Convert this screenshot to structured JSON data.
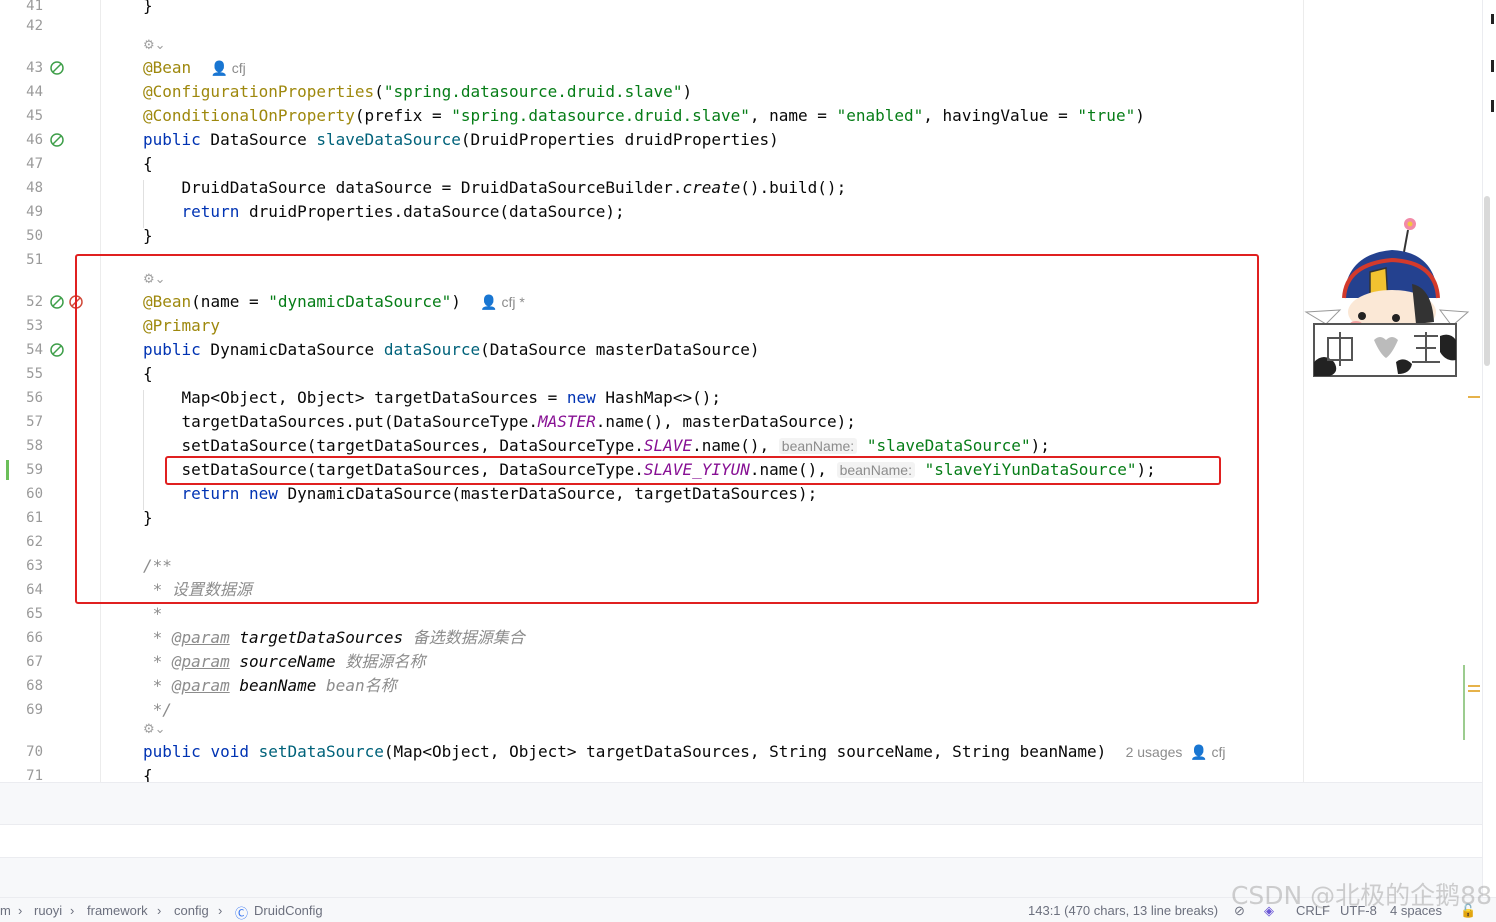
{
  "editor": {
    "lines": [
      {
        "n": "41",
        "html": "}"
      },
      {
        "n": "42",
        "html": ""
      },
      {
        "n": "43",
        "html": "<span class='a'>@Bean</span>  <span class='meta'>&#128100; cfj</span>"
      },
      {
        "n": "44",
        "html": "<span class='a'>@ConfigurationProperties</span>(<span class='s'>\"spring.datasource.druid.slave\"</span>)"
      },
      {
        "n": "45",
        "html": "<span class='a'>@ConditionalOnProperty</span>(prefix = <span class='s'>\"spring.datasource.druid.slave\"</span>, name = <span class='s'>\"enabled\"</span>, havingValue = <span class='s'>\"true\"</span>)"
      },
      {
        "n": "46",
        "html": "<span class='k'>public</span> DataSource <span class='f'>slaveDataSource</span>(DruidProperties druidProperties)"
      },
      {
        "n": "47",
        "html": "{"
      },
      {
        "n": "48",
        "html": "    DruidDataSource dataSource = DruidDataSourceBuilder.<span class='it'>create</span>().build();"
      },
      {
        "n": "49",
        "html": "    <span class='k'>return</span> druidProperties.dataSource(dataSource);"
      },
      {
        "n": "50",
        "html": "}"
      },
      {
        "n": "51",
        "html": ""
      },
      {
        "n": "52",
        "html": "<span class='a'>@Bean</span>(name = <span class='s'>\"dynamicDataSource\"</span>)  <span class='meta'>&#128100; cfj *</span>"
      },
      {
        "n": "53",
        "html": "<span class='a'>@Primary</span>"
      },
      {
        "n": "54",
        "html": "<span class='k'>public</span> DynamicDataSource <span class='f'>dataSource</span>(DataSource masterDataSource)"
      },
      {
        "n": "55",
        "html": "{"
      },
      {
        "n": "56",
        "html": "    Map&lt;Object, Object&gt; targetDataSources = <span class='k'>new</span> HashMap&lt;&gt;();"
      },
      {
        "n": "57",
        "html": "    targetDataSources.put(DataSourceType.<span class='st'>MASTER</span>.name(), masterDataSource);"
      },
      {
        "n": "58",
        "html": "    setDataSource(targetDataSources, DataSourceType.<span class='st'>SLAVE</span>.name(), <span class='hint'>beanName:</span> <span class='s'>\"slaveDataSource\"</span>);"
      },
      {
        "n": "59",
        "html": "    setDataSource(targetDataSources, DataSourceType.<span class='st'>SLAVE_YIYUN</span>.name(), <span class='hint'>beanName:</span> <span class='s'>\"slaveYiYunDataSource\"</span>);"
      },
      {
        "n": "60",
        "html": "    <span class='k'>return</span> <span class='k'>new</span> DynamicDataSource(masterDataSource, targetDataSources);"
      },
      {
        "n": "61",
        "html": "}"
      },
      {
        "n": "62",
        "html": ""
      },
      {
        "n": "63",
        "html": "<span class='c'>/**</span>"
      },
      {
        "n": "64",
        "html": "<span class='c'> * 设置数据源</span>"
      },
      {
        "n": "65",
        "html": "<span class='c'> *</span>"
      },
      {
        "n": "66",
        "html": "<span class='c'> * </span><span class='cu'>@param</span> <span class='pb'>targetDataSources</span> <span class='c'>备选数据源集合</span>"
      },
      {
        "n": "67",
        "html": "<span class='c'> * </span><span class='cu'>@param</span> <span class='pb'>sourceName</span> <span class='c'>数据源名称</span>"
      },
      {
        "n": "68",
        "html": "<span class='c'> * </span><span class='cu'>@param</span> <span class='pb'>beanName</span> <span class='c'>bean名称</span>"
      },
      {
        "n": "69",
        "html": "<span class='c'> */</span>"
      },
      {
        "n": "70",
        "html": "<span class='k'>public</span> <span class='k'>void</span> <span class='f'>setDataSource</span>(Map&lt;Object, Object&gt; targetDataSources, String sourceName, String beanName)  <span class='meta'>2 usages  &#128100; cfj</span>"
      },
      {
        "n": "71",
        "html": "{"
      }
    ]
  },
  "breadcrumb": {
    "items": [
      "m",
      "ruoyi",
      "framework",
      "config",
      "DruidConfig"
    ]
  },
  "status_bar": {
    "position": "143:1 (470 chars, 13 line breaks)",
    "line_ending": "CRLF",
    "encoding": "UTF-8",
    "indent": "4 spaces"
  },
  "watermark": "CSDN @北极的企鹅88",
  "icon_names": [
    "spring-bean-icon",
    "gear-icon",
    "user-icon",
    "branch-icon"
  ],
  "colors": {
    "highlight_box": "#e02020",
    "keyword": "#0033b3",
    "string": "#067d17",
    "annotation": "#9e880d"
  }
}
